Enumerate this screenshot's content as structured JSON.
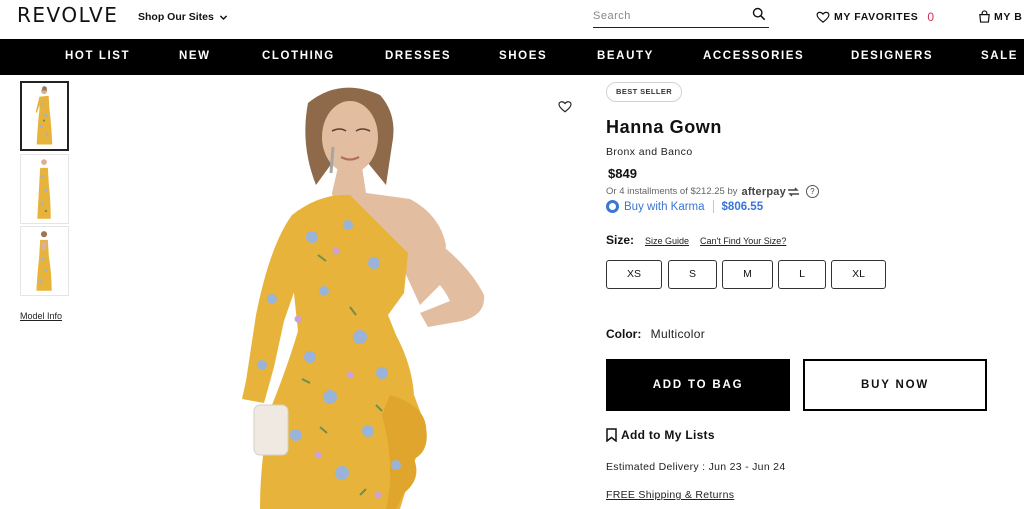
{
  "header": {
    "logo": "REVOLVE",
    "shop_sites": "Shop Our Sites",
    "search_placeholder": "Search",
    "favorites_label": "MY FAVORITES",
    "favorites_count": "0",
    "bag_label": "MY B"
  },
  "nav": [
    {
      "label": "HOT LIST"
    },
    {
      "label": "NEW"
    },
    {
      "label": "CLOTHING"
    },
    {
      "label": "DRESSES"
    },
    {
      "label": "SHOES"
    },
    {
      "label": "BEAUTY"
    },
    {
      "label": "ACCESSORIES"
    },
    {
      "label": "DESIGNERS"
    },
    {
      "label": "SALE"
    }
  ],
  "gallery": {
    "model_info": "Model Info"
  },
  "product": {
    "badge": "BEST SELLER",
    "title": "Hanna Gown",
    "brand": "Bronx and Banco",
    "price": "$849",
    "installments_text": "Or 4 installments of $212.25 by",
    "afterpay_label": "afterpay",
    "info_icon_text": "?",
    "karma_label": "Buy with Karma",
    "karma_price": "$806.55",
    "size_label": "Size:",
    "size_guide": "Size Guide",
    "cant_find_size": "Can't Find Your Size?",
    "sizes": [
      "XS",
      "S",
      "M",
      "L",
      "XL"
    ],
    "color_label": "Color:",
    "color_value": "Multicolor",
    "add_to_bag": "ADD TO BAG",
    "buy_now": "BUY NOW",
    "add_to_lists": "Add to My Lists",
    "estimated_delivery": "Estimated Delivery : Jun 23 - Jun 24",
    "shipping_returns": "FREE Shipping & Returns"
  },
  "colors": {
    "accent_pink": "#d1315a",
    "karma_blue": "#3b75d6",
    "dress_yellow": "#e8b33a"
  }
}
